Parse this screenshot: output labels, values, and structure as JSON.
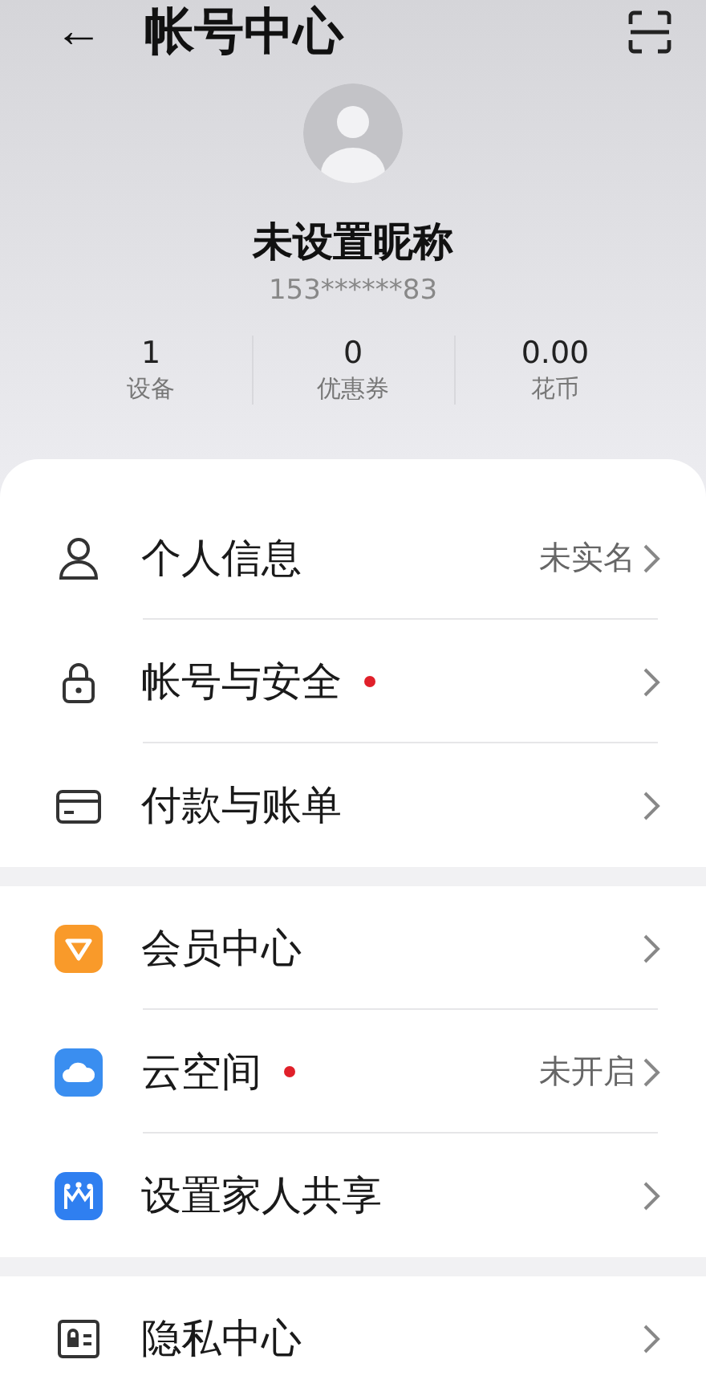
{
  "header": {
    "back": "←",
    "title": "帐号中心"
  },
  "profile": {
    "nickname": "未设置昵称",
    "phone": "153******83"
  },
  "stats": [
    {
      "value": "1",
      "label": "设备"
    },
    {
      "value": "0",
      "label": "优惠券"
    },
    {
      "value": "0.00",
      "label": "花币"
    }
  ],
  "groups": [
    {
      "rows": [
        {
          "label": "个人信息",
          "value": "未实名",
          "unread": false
        },
        {
          "label": "帐号与安全",
          "unread": true
        },
        {
          "label": "付款与账单",
          "unread": false
        }
      ]
    },
    {
      "rows": [
        {
          "label": "会员中心",
          "unread": false
        },
        {
          "label": "云空间",
          "value": "未开启",
          "unread": true
        },
        {
          "label": "设置家人共享",
          "unread": false
        }
      ]
    },
    {
      "rows": [
        {
          "label": "隐私中心",
          "unread": false
        }
      ]
    }
  ]
}
